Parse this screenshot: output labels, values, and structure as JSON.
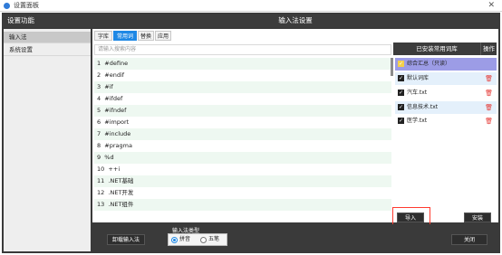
{
  "window": {
    "title": "设置面板",
    "close_glyph": "✕",
    "app_icon": "settings-app-icon"
  },
  "left_panel": {
    "header": "设置功能",
    "items": [
      {
        "label": "输入法",
        "active": true
      },
      {
        "label": "系统设置",
        "active": false
      }
    ]
  },
  "main": {
    "header": "输入法设置",
    "tabs": [
      {
        "label": "字库",
        "active": false
      },
      {
        "label": "常用词",
        "active": true
      },
      {
        "label": "替换",
        "active": false
      },
      {
        "label": "应用",
        "active": false
      }
    ],
    "search_placeholder": "请输入搜索内容",
    "rows": [
      {
        "index": "1",
        "text": "#define"
      },
      {
        "index": "2",
        "text": "#endif"
      },
      {
        "index": "3",
        "text": "#if"
      },
      {
        "index": "4",
        "text": "#ifdef"
      },
      {
        "index": "5",
        "text": "#ifndef"
      },
      {
        "index": "6",
        "text": "#import"
      },
      {
        "index": "7",
        "text": "#include"
      },
      {
        "index": "8",
        "text": "#pragma"
      },
      {
        "index": "9",
        "text": "%d"
      },
      {
        "index": "10",
        "text": "++i"
      },
      {
        "index": "11",
        "text": ".NET基础"
      },
      {
        "index": "12",
        "text": ".NET开发"
      },
      {
        "index": "13",
        "text": ".NET组件"
      }
    ]
  },
  "dictionaries": {
    "header": "已安装常用词库",
    "op_header": "操作",
    "items": [
      {
        "label": "综合汇总（只读）",
        "checked": true,
        "deletable": false,
        "style": "sel"
      },
      {
        "label": "默认词库",
        "checked": true,
        "deletable": true,
        "style": "blue"
      },
      {
        "label": "汽车.txt",
        "checked": true,
        "deletable": true,
        "style": "white"
      },
      {
        "label": "信息技术.txt",
        "checked": true,
        "deletable": true,
        "style": "blue"
      },
      {
        "label": "医学.txt",
        "checked": true,
        "deletable": true,
        "style": "white"
      }
    ],
    "check_glyph": "✓",
    "trash_glyph": "🗑",
    "import_label": "导入",
    "install_label": "安装"
  },
  "footer": {
    "uninstall_label": "卸载输入法",
    "type_label": "输入法类型",
    "options": [
      {
        "label": "拼音",
        "selected": true
      },
      {
        "label": "五笔",
        "selected": false
      }
    ],
    "close_label": "关闭"
  }
}
